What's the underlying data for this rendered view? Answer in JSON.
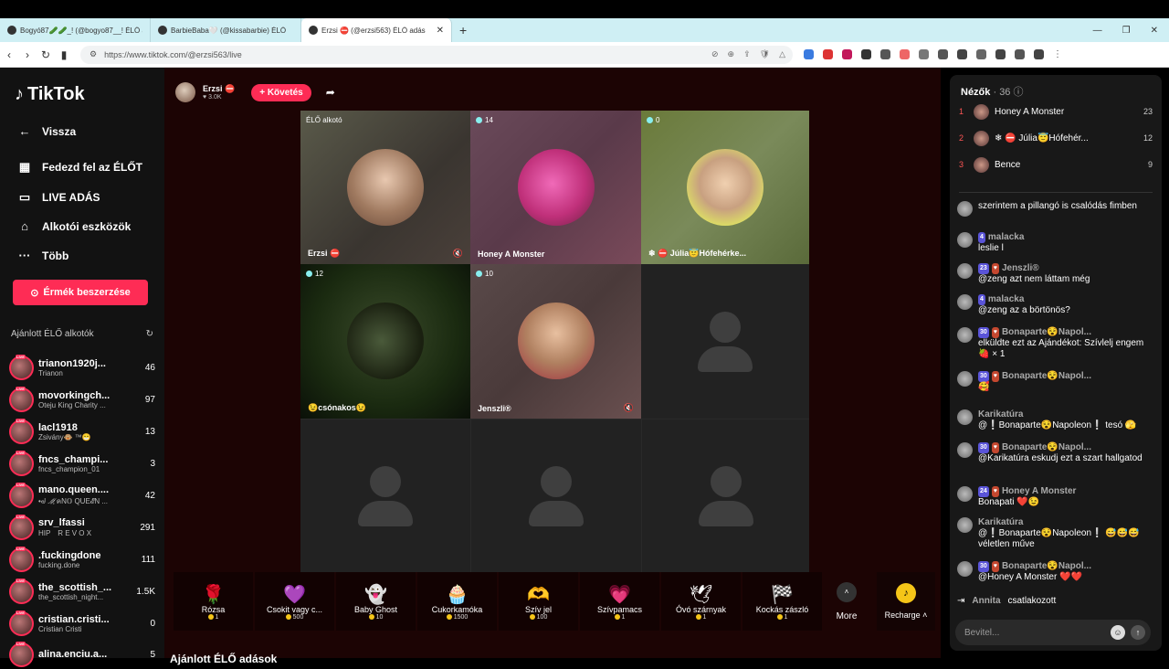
{
  "browser": {
    "tabs": [
      {
        "title": "Bogyó87🥒🥒_! (@bogyo87__! ÉLŐ ad...",
        "active": false
      },
      {
        "title": "BarbieBaba🤍 (@kissabarbie) ÉLŐ",
        "active": false
      },
      {
        "title": "Erzsi ⛔ (@erzsi563) ÉLŐ adás",
        "active": true
      }
    ],
    "url": "https://www.tiktok.com/@erzsi563/live"
  },
  "sidebar": {
    "logo": "TikTok",
    "nav": [
      {
        "label": "Vissza",
        "icon": "arrow-left-icon"
      },
      {
        "label": "Fedezd fel az ÉLŐT",
        "icon": "calendar-icon"
      },
      {
        "label": "LIVE ADÁS",
        "icon": "video-icon"
      },
      {
        "label": "Alkotói eszközök",
        "icon": "lightbulb-icon"
      },
      {
        "label": "Több",
        "icon": "more-icon"
      }
    ],
    "coin_button": "Érmék beszerzése",
    "recommended_label": "Ajánlott ÉLŐ alkotók",
    "creators": [
      {
        "name": "trianon1920j...",
        "sub": "Trianon",
        "count": "46"
      },
      {
        "name": "movorkingch...",
        "sub": "Oteju King Charity ...",
        "count": "97"
      },
      {
        "name": "lacl1918",
        "sub": "Zsivány🐵 ™😁",
        "count": "13"
      },
      {
        "name": "fncs_champi...",
        "sub": "fncs_champion_01",
        "count": "3"
      },
      {
        "name": "mano.queen....",
        "sub": "•ᖙ ℳคN𝕆 QUE𝓔N ...",
        "count": "42"
      },
      {
        "name": "srv_lfassi",
        "sub": "HIP　R E V O X",
        "count": "291"
      },
      {
        "name": ".fuckingdone",
        "sub": "fucking.done",
        "count": "111"
      },
      {
        "name": "the_scottish_...",
        "sub": "the_scottish_night...",
        "count": "1.5K"
      },
      {
        "name": "cristian.cristi...",
        "sub": "Cristian Cristi",
        "count": "0"
      },
      {
        "name": "alina.enciu.a...",
        "sub": "",
        "count": "5"
      }
    ]
  },
  "host": {
    "name": "Erzsi ⛔",
    "likes": "♥ 3.0K",
    "follow_label": "+ Követés"
  },
  "grid": {
    "cells": [
      {
        "badge": "ÉLŐ alkotó",
        "name": "Erzsi ⛔",
        "muted": true,
        "kind": "video"
      },
      {
        "badge": "14",
        "name": "Honey A Monster",
        "muted": false,
        "kind": "video"
      },
      {
        "badge": "0",
        "name": "❄ ⛔ Júlia😇Hófehérke...",
        "muted": false,
        "kind": "video"
      },
      {
        "badge": "12",
        "name": "😉csónakos😉",
        "muted": false,
        "kind": "video"
      },
      {
        "badge": "10",
        "name": "Jenszli®",
        "muted": true,
        "kind": "video"
      },
      {
        "badge": "",
        "name": "",
        "muted": false,
        "kind": "empty"
      },
      {
        "badge": "",
        "name": "",
        "muted": false,
        "kind": "empty"
      },
      {
        "badge": "",
        "name": "",
        "muted": false,
        "kind": "empty"
      },
      {
        "badge": "",
        "name": "",
        "muted": false,
        "kind": "empty"
      }
    ]
  },
  "gifts": [
    {
      "name": "Rózsa",
      "price": "1",
      "icon": "🌹"
    },
    {
      "name": "Csokit vagy c...",
      "price": "500",
      "icon": "💜"
    },
    {
      "name": "Baby Ghost",
      "price": "10",
      "icon": "👻"
    },
    {
      "name": "Cukorkamóka",
      "price": "1500",
      "icon": "🧁"
    },
    {
      "name": "Szív jel",
      "price": "100",
      "icon": "🫶"
    },
    {
      "name": "Szívpamacs",
      "price": "1",
      "icon": "💗"
    },
    {
      "name": "Óvó szárnyak",
      "price": "1",
      "icon": "🕊"
    },
    {
      "name": "Kockás zászló",
      "price": "1",
      "icon": "🏁"
    }
  ],
  "more_label": "More",
  "recharge_label": "Recharge ˄",
  "recommended_live_label": "Ajánlott ÉLŐ adások",
  "chat": {
    "viewers_title": "Nézők",
    "viewers_count": "· 36",
    "top_viewers": [
      {
        "rank": "1",
        "name": "Honey A Monster",
        "score": "23"
      },
      {
        "rank": "2",
        "name": "❄ ⛔ Júlia😇Hófehér...",
        "score": "12"
      },
      {
        "rank": "3",
        "name": "Bence",
        "score": "9"
      }
    ],
    "messages": [
      {
        "user": "",
        "level": "",
        "fan": "",
        "text": "szerintem a pillangó is csalódás fimben"
      },
      {
        "user": "malacka",
        "level": "4",
        "fan": "",
        "text": "leslie l"
      },
      {
        "user": "Jenszli®",
        "level": "23",
        "fan": "♥",
        "text": "@zeng azt nem láttam még"
      },
      {
        "user": "malacka",
        "level": "4",
        "fan": "",
        "text": "@zeng az a börtönös?"
      },
      {
        "user": "Bonaparte😵Napol...",
        "level": "30",
        "fan": "♥",
        "text": "elküldte ezt az Ajándékot: Szívlelj engem 🍓 × 1"
      },
      {
        "user": "Bonaparte😵Napol...",
        "level": "30",
        "fan": "♥",
        "text": "🥰"
      },
      {
        "user": "Karikatúra",
        "level": "",
        "fan": "",
        "text": "@❕Bonaparte😵Napoleon❕ tesó 🫣"
      },
      {
        "user": "Bonaparte😵Napol...",
        "level": "30",
        "fan": "♥",
        "text": "@Karikatúra eskudj ezt a szart hallgatod"
      },
      {
        "user": "Honey A Monster",
        "level": "24",
        "fan": "♥",
        "text": "Bonapati ❤️😉"
      },
      {
        "user": "Karikatúra",
        "level": "",
        "fan": "",
        "text": "@❕Bonaparte😵Napoleon❕ 😅😅😅 véletlen műve"
      },
      {
        "user": "Bonaparte😵Napol...",
        "level": "30",
        "fan": "♥",
        "text": "@Honey A Monster ❤️❤️"
      }
    ],
    "joined_user": "Annita",
    "joined_text": "csatlakozott",
    "input_placeholder": "Bevitel..."
  }
}
